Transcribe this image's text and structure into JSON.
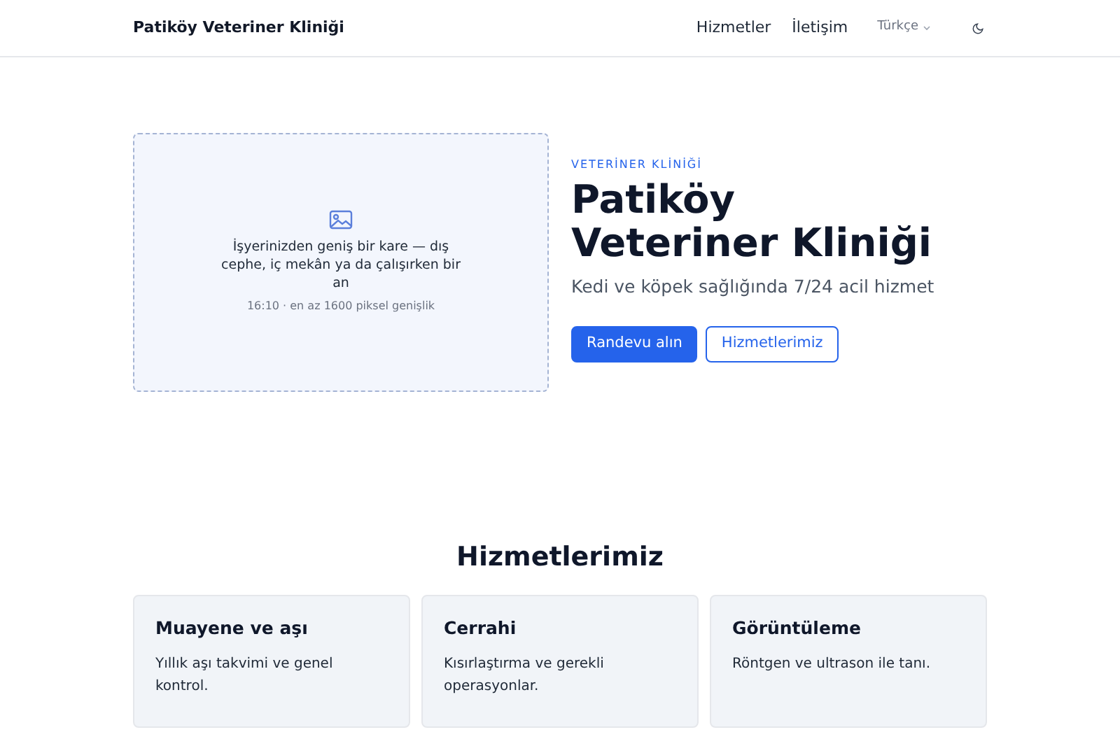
{
  "header": {
    "brand": "Patiköy Veteriner Kliniği",
    "nav": [
      "Hizmetler",
      "İletişim"
    ],
    "language": "Türkçe"
  },
  "hero": {
    "image_placeholder": {
      "caption": "İşyerinizden geniş bir kare — dış cephe, iç mekân ya da çalışırken bir an",
      "hint": "16:10 · en az 1600 piksel genişlik"
    },
    "eyebrow": "VETERİNER KLİNİĞİ",
    "title": "Patiköy Veteriner Kliniği",
    "subtitle": "Kedi ve köpek sağlığında 7/24 acil hizmet",
    "buttons": [
      {
        "label": "Randevu alın",
        "kind": "primary"
      },
      {
        "label": "Hizmetlerimiz",
        "kind": "outline"
      }
    ]
  },
  "services": {
    "title": "Hizmetlerimiz",
    "cards": [
      {
        "title": "Muayene ve aşı",
        "text": "Yıllık aşı takvimi ve genel kontrol."
      },
      {
        "title": "Cerrahi",
        "text": "Kısırlaştırma ve gerekli operasyonlar."
      },
      {
        "title": "Görüntüleme",
        "text": "Röntgen ve ultrason ile tanı."
      }
    ]
  }
}
